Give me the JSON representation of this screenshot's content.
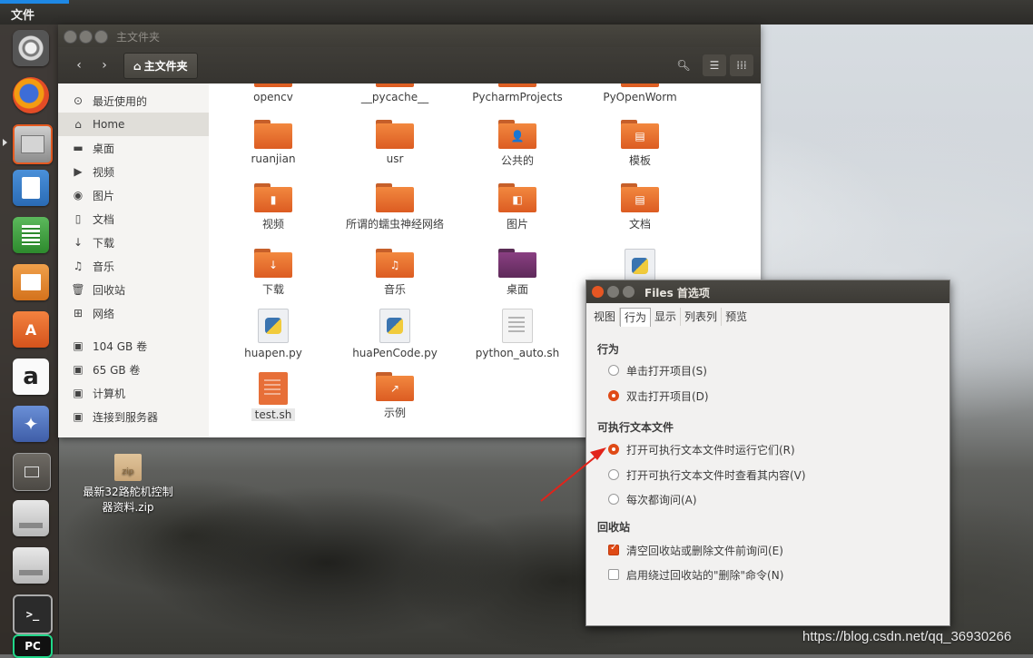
{
  "top_panel": {
    "title": "文件"
  },
  "launcher": {
    "icons": [
      "ubuntu-logo-icon",
      "firefox-icon",
      "files-icon",
      "writer-icon",
      "calc-icon",
      "impress-icon",
      "software-center-icon",
      "amazon-icon",
      "system-settings-icon",
      "workspace-switcher-icon",
      "drive-icon",
      "drive-icon",
      "terminal-icon",
      "pycharm-icon"
    ],
    "terminal_glyph": ">_",
    "pycharm_glyph": "PC",
    "amazon_glyph": "a"
  },
  "file_manager": {
    "window_title": "主文件夹",
    "breadcrumb": {
      "icon": "home-icon",
      "label": "主文件夹"
    },
    "nav": {
      "back": "‹",
      "forward": "›"
    },
    "sidebar": [
      {
        "icon": "recent-icon",
        "glyph": "⊙",
        "label": "最近使用的"
      },
      {
        "icon": "home-icon",
        "glyph": "⌂",
        "label": "Home"
      },
      {
        "icon": "folder-icon",
        "glyph": "▬",
        "label": "桌面"
      },
      {
        "icon": "video-icon",
        "glyph": "▶",
        "label": "视频"
      },
      {
        "icon": "camera-icon",
        "glyph": "◉",
        "label": "图片"
      },
      {
        "icon": "document-icon",
        "glyph": "▯",
        "label": "文档"
      },
      {
        "icon": "download-icon",
        "glyph": "↓",
        "label": "下载"
      },
      {
        "icon": "music-icon",
        "glyph": "♫",
        "label": "音乐"
      },
      {
        "icon": "trash-icon",
        "glyph": "🗑",
        "label": "回收站"
      },
      {
        "icon": "network-icon",
        "glyph": "⊞",
        "label": "网络"
      },
      {
        "icon": "drive-icon",
        "glyph": "▣",
        "label": "104 GB 卷"
      },
      {
        "icon": "drive-icon",
        "glyph": "▣",
        "label": "65 GB 卷"
      },
      {
        "icon": "computer-icon",
        "glyph": "▣",
        "label": "计算机"
      },
      {
        "icon": "server-icon",
        "glyph": "▣",
        "label": "连接到服务器"
      }
    ],
    "files": [
      {
        "name": "opencv",
        "kind": "folder",
        "emblem": ""
      },
      {
        "name": "__pycache__",
        "kind": "folder",
        "emblem": ""
      },
      {
        "name": "PycharmProjects",
        "kind": "folder",
        "emblem": ""
      },
      {
        "name": "PyOpenWorm",
        "kind": "folder",
        "emblem": ""
      },
      {
        "name": "ruanjian",
        "kind": "folder",
        "emblem": ""
      },
      {
        "name": "usr",
        "kind": "folder",
        "emblem": ""
      },
      {
        "name": "公共的",
        "kind": "folder",
        "emblem": "👤"
      },
      {
        "name": "模板",
        "kind": "folder",
        "emblem": "▤"
      },
      {
        "name": "视频",
        "kind": "folder",
        "emblem": "▮"
      },
      {
        "name": "所谓的蠕虫神经网络",
        "kind": "folder",
        "emblem": ""
      },
      {
        "name": "图片",
        "kind": "folder",
        "emblem": "◧"
      },
      {
        "name": "文档",
        "kind": "folder",
        "emblem": "▤"
      },
      {
        "name": "下载",
        "kind": "folder",
        "emblem": "↓"
      },
      {
        "name": "音乐",
        "kind": "folder",
        "emblem": "♫"
      },
      {
        "name": "桌面",
        "kind": "desktop",
        "emblem": ""
      },
      {
        "name": "",
        "kind": "python",
        "emblem": ""
      },
      {
        "name": "huapen.py",
        "kind": "python",
        "emblem": ""
      },
      {
        "name": "huaPenCode.py",
        "kind": "python",
        "emblem": ""
      },
      {
        "name": "python_auto.sh",
        "kind": "text",
        "emblem": ""
      },
      {
        "name": "test.sh",
        "kind": "script",
        "emblem": ""
      },
      {
        "name": "示例",
        "kind": "folder",
        "emblem": "↗"
      }
    ]
  },
  "desktop": {
    "zip_icon_text": "zip",
    "zip_label": "最新32路舵机控制器资料.zip"
  },
  "preferences": {
    "window_title": "Files 首选项",
    "tabs": [
      "视图",
      "行为",
      "显示",
      "列表列",
      "预览"
    ],
    "active_tab": "行为",
    "sections": {
      "behavior": {
        "heading": "行为",
        "options": [
          "单击打开项目(S)",
          "双击打开项目(D)"
        ],
        "selected": 1
      },
      "executable": {
        "heading": "可执行文本文件",
        "options": [
          "打开可执行文本文件时运行它们(R)",
          "打开可执行文本文件时查看其内容(V)",
          "每次都询问(A)"
        ],
        "selected": 0
      },
      "trash": {
        "heading": "回收站",
        "checks": [
          {
            "label": "清空回收站或删除文件前询问(E)",
            "checked": true
          },
          {
            "label": "启用绕过回收站的\"删除\"命令(N)",
            "checked": false
          }
        ]
      }
    }
  },
  "watermark": "https://blog.csdn.net/qq_36930266",
  "colors": {
    "accent": "#df4a16",
    "folder": "#e8733a",
    "arrow": "#e2231a"
  }
}
